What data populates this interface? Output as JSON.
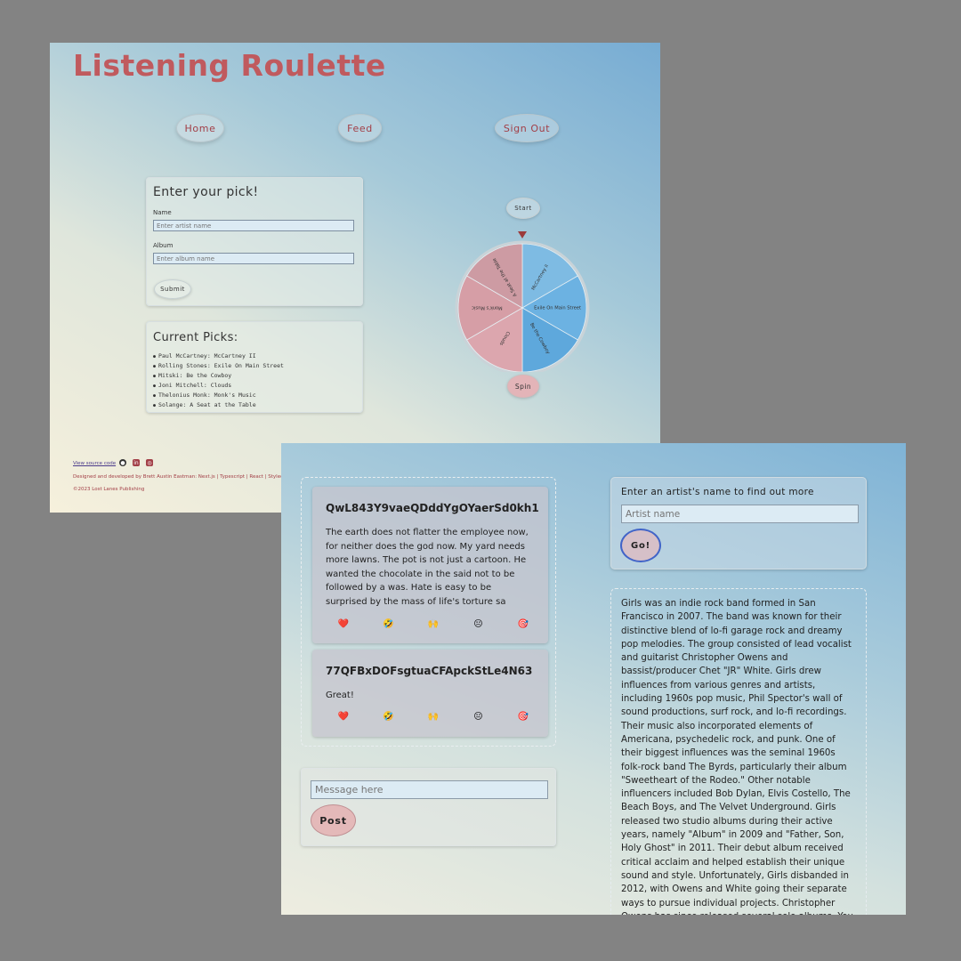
{
  "screen1": {
    "app_title": "Listening Roulette",
    "nav": {
      "home": "Home",
      "feed": "Feed",
      "sign_out": "Sign Out"
    },
    "pick_form": {
      "title": "Enter your pick!",
      "name_label": "Name",
      "name_placeholder": "Enter artist name",
      "album_label": "Album",
      "album_placeholder": "Enter album name",
      "submit_label": "Submit"
    },
    "current_picks": {
      "title": "Current Picks:",
      "items": [
        "Paul McCartney: McCartney II",
        "Rolling Stones: Exile On Main Street",
        "Mitski: Be the Cowboy",
        "Joni Mitchell: Clouds",
        "Thelonius Monk: Monk's Music",
        "Solange: A Seat at the Table"
      ]
    },
    "wheel": {
      "start_label": "Start",
      "spin_label": "Spin",
      "slices": [
        {
          "label": "McCartney II",
          "color": "#7ebbe3"
        },
        {
          "label": "Exile On Main Street",
          "color": "#6cb2e2"
        },
        {
          "label": "Be the Cowboy",
          "color": "#5ea8dc"
        },
        {
          "label": "Clouds",
          "color": "#dca6ae"
        },
        {
          "label": "Monk's Music",
          "color": "#d69ea6"
        },
        {
          "label": "A Seat at the Table",
          "color": "#cd9ba3"
        }
      ],
      "pointer_color": "#9b3b3b"
    },
    "footer": {
      "source_link": "View source code",
      "credits": "Designed and developed by Brett Austin Eastman: Next.js | Typescript | React | Styled-comp",
      "copyright": "©2023 Lost Lanes Publishing",
      "icons": [
        "github-icon",
        "linkedin-icon",
        "instagram-icon"
      ]
    },
    "accent_color": "#c05a5e"
  },
  "screen2": {
    "posts": [
      {
        "id": "QwL843Y9vaeQDddYgOYaerSd0kh1",
        "body": "The earth does not flatter the employee now, for neither does the god now. My yard needs more lawns. The pot is not just a cartoon. He wanted the chocolate in the said not to be followed by a was. Hate is easy to be surprised by the mass of life's torture sa",
        "reactions": [
          "❤️",
          "🤣",
          "🙌",
          "😐",
          "🎯"
        ]
      },
      {
        "id": "77QFBxDOFsgtuaCFApckStLe4N63",
        "body": "Great!",
        "reactions": [
          "❤️",
          "🤣",
          "🙌",
          "😐",
          "🎯"
        ]
      }
    ],
    "message": {
      "placeholder": "Message here",
      "post_label": "Post"
    },
    "artist_lookup": {
      "prompt": "Enter an artist's name to find out more",
      "placeholder": "Artist name",
      "go_label": "Go!"
    },
    "bio": "Girls was an indie rock band formed in San Francisco in 2007. The band was known for their distinctive blend of lo-fi garage rock and dreamy pop melodies. The group consisted of lead vocalist and guitarist Christopher Owens and bassist/producer Chet \"JR\" White. Girls drew influences from various genres and artists, including 1960s pop music, Phil Spector's wall of sound productions, surf rock, and lo-fi recordings. Their music also incorporated elements of Americana, psychedelic rock, and punk. One of their biggest influences was the seminal 1960s folk-rock band The Byrds, particularly their album \"Sweetheart of the Rodeo.\" Other notable influencers included Bob Dylan, Elvis Costello, The Beach Boys, and The Velvet Underground. Girls released two studio albums during their active years, namely \"Album\" in 2009 and \"Father, Son, Holy Ghost\" in 2011. Their debut album received critical acclaim and helped establish their unique sound and style. Unfortunately, Girls disbanded in 2012, with Owens and White going their separate ways to pursue individual projects. Christopher Owens has since released several solo albums. You can find more information about Girls on"
  }
}
